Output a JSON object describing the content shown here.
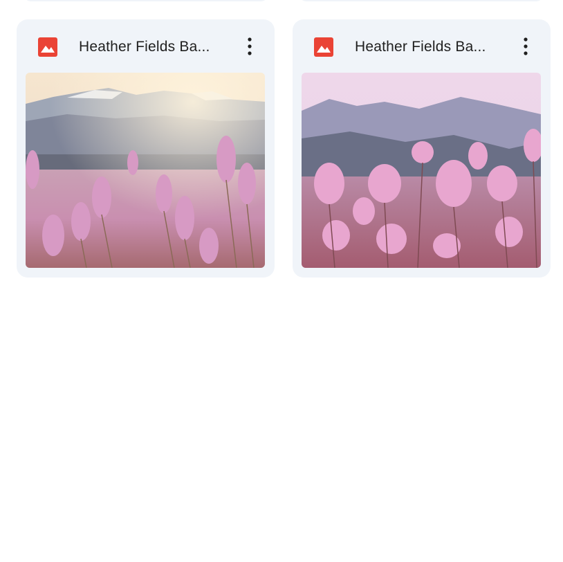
{
  "files": [
    {
      "name": "Heather Fields Ba...",
      "icon": "image-file-icon",
      "thumbnail": "pink-heather-field-sunrise"
    },
    {
      "name": "Heather Fields Ba...",
      "icon": "image-file-icon",
      "thumbnail": "pink-heather-field-mountains"
    }
  ],
  "colors": {
    "card_bg": "#f0f4f9",
    "icon_red": "#ea4335",
    "text": "#1f1f1f"
  }
}
